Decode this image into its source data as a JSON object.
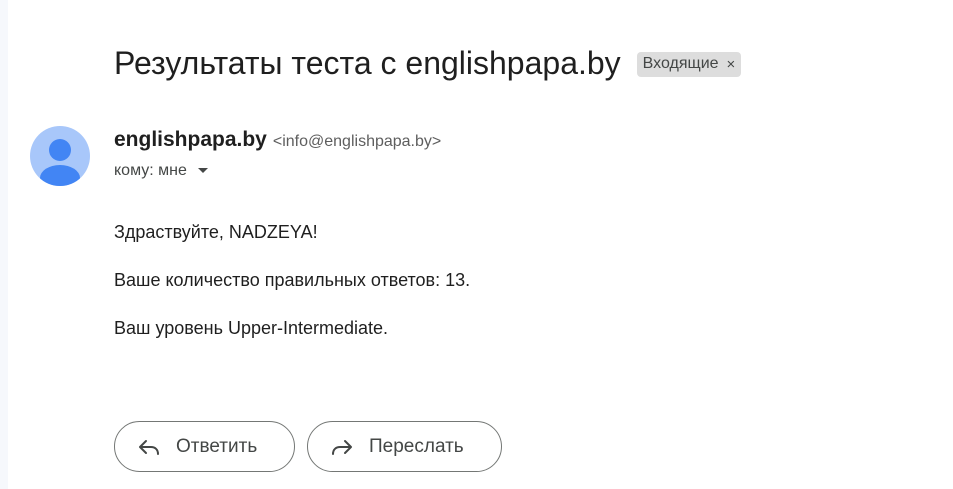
{
  "email": {
    "subject": "Результаты теста с englishpapa.by",
    "label": {
      "text": "Входящие",
      "remove_glyph": "×"
    },
    "sender": {
      "name": "englishpapa.by",
      "email": "<info@englishpapa.by>",
      "avatar_icon": "person-icon"
    },
    "recipient": "кому: мне",
    "body": [
      "Здраствуйте, NADZEYA!",
      "Ваше количество правильных ответов: 13.",
      "Ваш уровень Upper-Intermediate."
    ]
  },
  "actions": {
    "reply": {
      "label": "Ответить",
      "icon": "reply-icon"
    },
    "forward": {
      "label": "Переслать",
      "icon": "forward-icon"
    }
  },
  "colors": {
    "avatar_bg": "#a8c7fa",
    "avatar_fg": "#4285f4",
    "label_bg": "#dddddd"
  }
}
